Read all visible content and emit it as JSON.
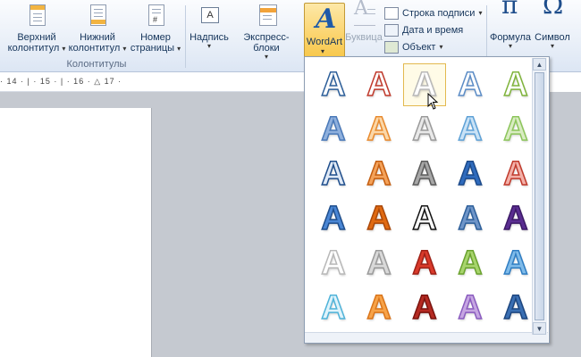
{
  "ribbon": {
    "header_footer_group": {
      "label": "Колонтитулы",
      "buttons": [
        {
          "line1": "Верхний",
          "line2": "колонтитул"
        },
        {
          "line1": "Нижний",
          "line2": "колонтитул"
        },
        {
          "line1": "Номер",
          "line2": "страницы"
        }
      ]
    },
    "text_group": {
      "textbox": "Надпись",
      "quickparts": "Экспресс-блоки",
      "wordart": "WordArt",
      "dropcap": "Буквица",
      "signature_line": "Строка подписи",
      "datetime": "Дата и время",
      "object": "Объект"
    },
    "symbols_group": {
      "equation": "Формула",
      "symbol": "Символ",
      "pi": "π",
      "omega": "Ω"
    }
  },
  "ruler": {
    "text": "· 14 · | · 15 · | · 16 · △ 17 ·"
  },
  "wordart_gallery": {
    "glyph": "A",
    "selected_index": 2,
    "styles": [
      {
        "fill": "#ffffff",
        "stroke": "#2d5f9a"
      },
      {
        "fill": "#ffffff",
        "stroke": "#c0392b"
      },
      {
        "fill": "#ffffff",
        "stroke": "#b8b8b8"
      },
      {
        "fill": "#ffffff",
        "stroke": "#5b8cc6"
      },
      {
        "fill": "#ffffff",
        "stroke": "#7fb33b"
      },
      {
        "fill": "#8fb0dd",
        "stroke": "#4a79b8"
      },
      {
        "fill": "#fbd7a8",
        "stroke": "#e88a2e"
      },
      {
        "fill": "#e9e9e9",
        "stroke": "#9a9a9a"
      },
      {
        "fill": "#c9e2f6",
        "stroke": "#5ea1d6"
      },
      {
        "fill": "#d9ecc2",
        "stroke": "#8cc55b"
      },
      {
        "fill": "#dfe9f6",
        "stroke": "#1f4e8c"
      },
      {
        "fill": "#f4a25a",
        "stroke": "#c45d0f"
      },
      {
        "fill": "#a7a7a7",
        "stroke": "#5c5c5c"
      },
      {
        "fill": "#2f6bbd",
        "stroke": "#1c4a8a"
      },
      {
        "fill": "#f3b0a8",
        "stroke": "#c0392b"
      },
      {
        "fill": "#4a86d4",
        "stroke": "#1f4e8c"
      },
      {
        "fill": "#e06a12",
        "stroke": "#a9480a"
      },
      {
        "fill": "#ffffff",
        "stroke": "#111111"
      },
      {
        "fill": "#6f95c8",
        "stroke": "#2d5f9a"
      },
      {
        "fill": "#5a2d91",
        "stroke": "#3c1a66"
      },
      {
        "fill": "#ffffff",
        "stroke": "#b8b8b8"
      },
      {
        "fill": "#d9d9d9",
        "stroke": "#9a9a9a"
      },
      {
        "fill": "#d93a2b",
        "stroke": "#9e2016"
      },
      {
        "fill": "#a7d46c",
        "stroke": "#6aa22e"
      },
      {
        "fill": "#7fbbe9",
        "stroke": "#2f7dc2"
      },
      {
        "fill": "#dff3fb",
        "stroke": "#4fb3d9"
      },
      {
        "fill": "#f7a348",
        "stroke": "#d9741a"
      },
      {
        "fill": "#b52a22",
        "stroke": "#7a130e"
      },
      {
        "fill": "#c6a6e2",
        "stroke": "#8a5cbf"
      },
      {
        "fill": "#3a6fb3",
        "stroke": "#1d467f"
      }
    ]
  }
}
